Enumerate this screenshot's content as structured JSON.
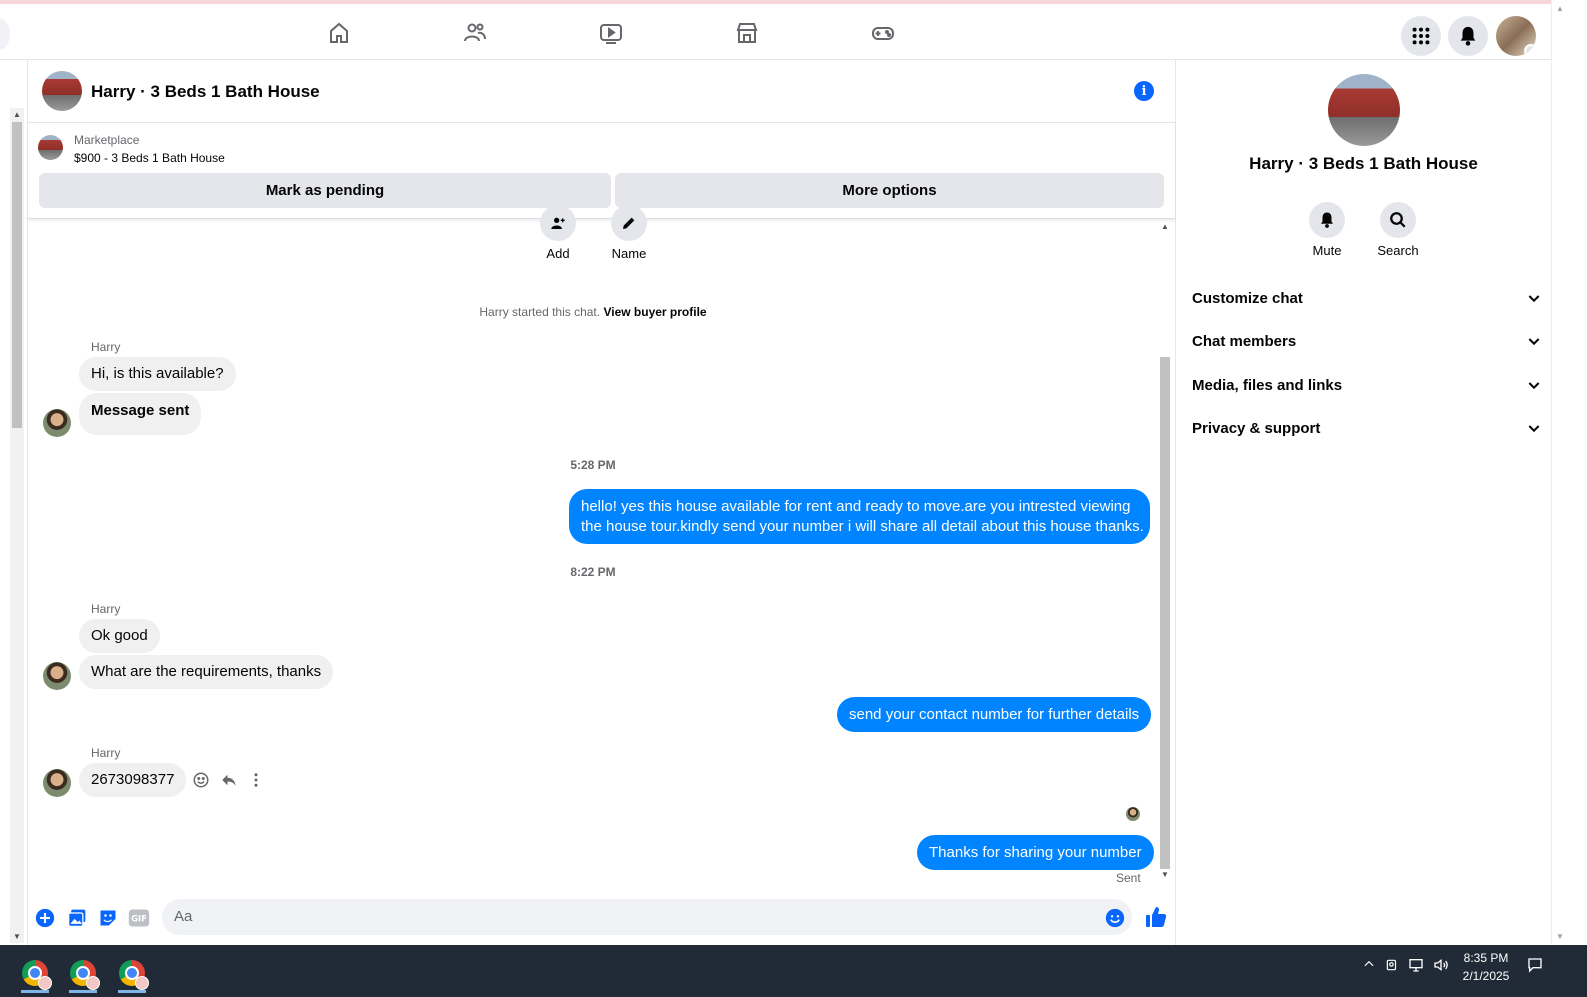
{
  "chat": {
    "title": "Harry · 3 Beds 1 Bath House",
    "marketplace": {
      "label": "Marketplace",
      "listing": "$900 - 3 Beds 1 Bath House",
      "mark_pending": "Mark as pending",
      "more_options": "More options"
    },
    "actions": {
      "add": "Add",
      "name": "Name"
    },
    "system": {
      "started": "Harry started this chat.",
      "view_profile": "View buyer profile"
    },
    "messages": [
      {
        "sender": "Harry",
        "text1": "Hi, is this available?",
        "text2": "Message sent"
      },
      {
        "time": "5:28 PM"
      },
      {
        "out": "hello! yes this house available for rent and ready to move.are you intrested viewing",
        "out2": "the house tour.kindly send your number i will share all detail about this house thanks."
      },
      {
        "time": "8:22 PM"
      },
      {
        "sender": "Harry",
        "text1": "Ok good",
        "text2": "What are the requirements, thanks"
      },
      {
        "out": "send your contact number for further details"
      },
      {
        "sender": "Harry",
        "text1": "2673098377"
      },
      {
        "out": "Thanks for sharing your number",
        "status": "Sent"
      }
    ],
    "composer": {
      "placeholder": "Aa"
    }
  },
  "right_panel": {
    "title": "Harry · 3 Beds 1 Bath House",
    "mute": "Mute",
    "search": "Search",
    "sections": [
      "Customize chat",
      "Chat members",
      "Media, files and links",
      "Privacy & support"
    ]
  },
  "taskbar": {
    "time": "8:35 PM",
    "date": "2/1/2025"
  },
  "colors": {
    "accent": "#0084ff",
    "brand": "#0866ff",
    "bubble_in": "#f0f0f0"
  }
}
